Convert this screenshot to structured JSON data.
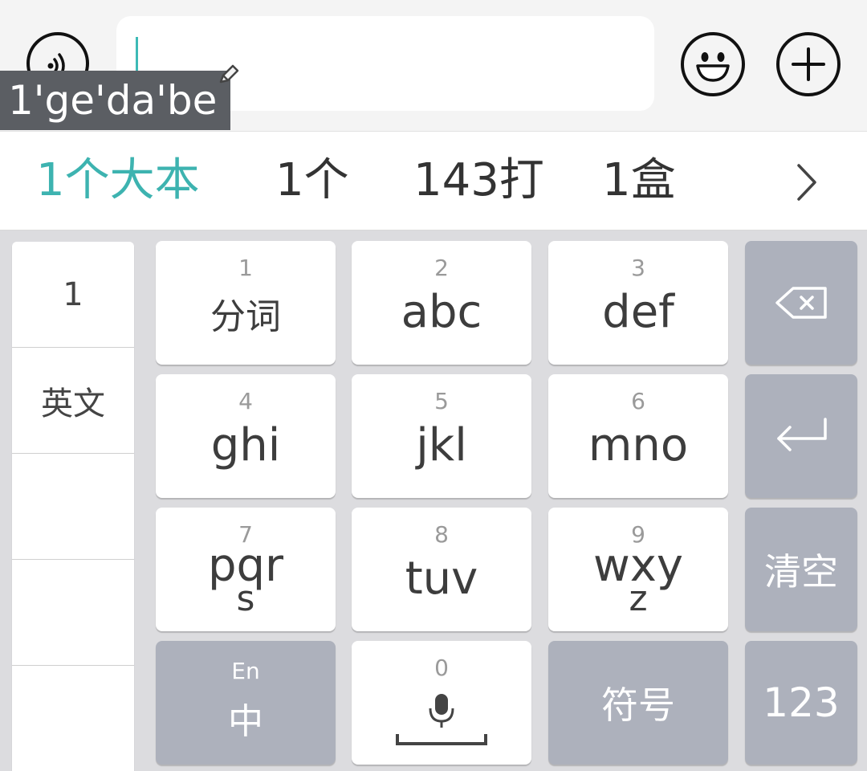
{
  "input": {
    "composing_text": "1'ge'da'be"
  },
  "candidates": [
    "1个大本",
    "1个",
    "143打",
    "1盒"
  ],
  "side_column": [
    "1",
    "英文",
    "",
    "",
    ""
  ],
  "keys": {
    "k1": {
      "num": "1",
      "label": "分词"
    },
    "k2": {
      "num": "2",
      "label": "abc"
    },
    "k3": {
      "num": "3",
      "label": "def"
    },
    "k4": {
      "num": "4",
      "label": "ghi"
    },
    "k5": {
      "num": "5",
      "label": "jkl"
    },
    "k6": {
      "num": "6",
      "label": "mno"
    },
    "k7": {
      "num": "7",
      "label": "pqr",
      "label2": "s"
    },
    "k8": {
      "num": "8",
      "label": "tuv"
    },
    "k9": {
      "num": "9",
      "label": "wxy",
      "label2": "z"
    },
    "lang": {
      "small": "En",
      "label": "中"
    },
    "k0": {
      "num": "0"
    },
    "symbols": {
      "label": "符号"
    },
    "clear": {
      "label": "清空"
    },
    "numeric": {
      "label": "123"
    }
  },
  "icons": {
    "voice": "voice-waves-icon",
    "emoji": "smiley-icon",
    "plus": "plus-icon",
    "edit": "pencil-icon",
    "expand": "chevron-right-icon",
    "backspace": "backspace-icon",
    "enter": "enter-icon",
    "mic": "microphone-icon"
  },
  "colors": {
    "accent": "#3db3b0",
    "function_key": "#adb1bc",
    "composing_bg": "#5b5e63"
  }
}
